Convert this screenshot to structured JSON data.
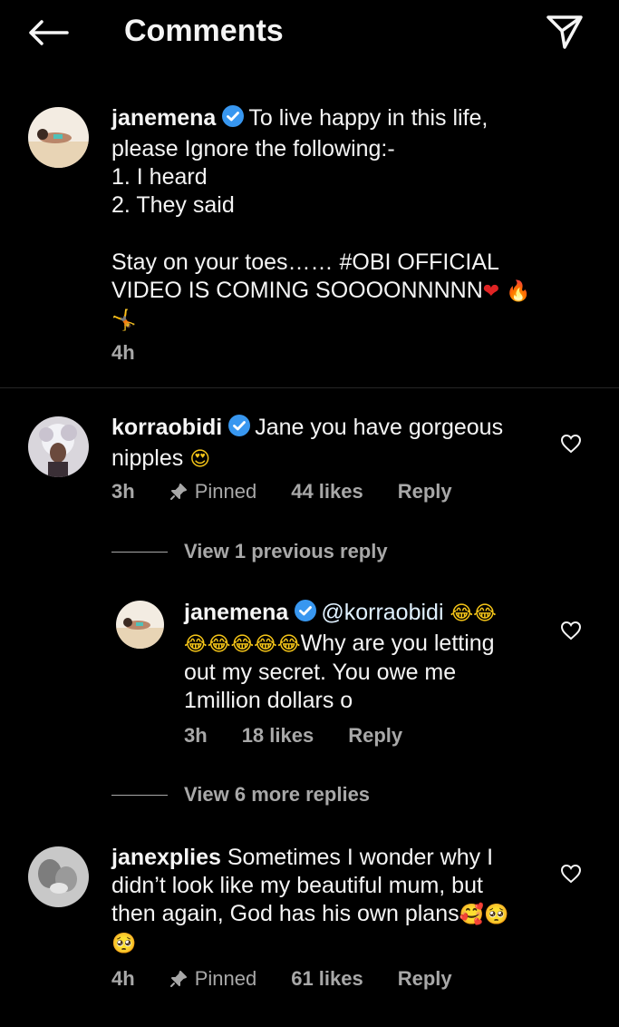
{
  "header": {
    "title": "Comments",
    "back_icon": "back-arrow-icon",
    "send_icon": "send-icon"
  },
  "colors": {
    "verified": "#3897f0",
    "muted": "#a8a8a8",
    "background": "#000000"
  },
  "caption": {
    "username": "janemena",
    "verified": true,
    "line1": "To live happy in this life,",
    "line2": "please Ignore the following:-",
    "line3": "1.  I heard",
    "line4": "2. They said",
    "line5": "Stay on your toes…… #OBI OFFICIAL",
    "line6": "VIDEO IS COMING SOOOONNNNN",
    "emoji_heart": "❤",
    "emoji_fire": "🔥",
    "emoji_person": "🤸",
    "time": "4h"
  },
  "comment1": {
    "username": "korraobidi",
    "verified": true,
    "text_a": "Jane you have gorgeous",
    "text_b": "nipples",
    "emoji": "😍",
    "time": "3h",
    "pinned": "Pinned",
    "likes": "44 likes",
    "reply": "Reply",
    "view_previous": "View 1 previous reply"
  },
  "reply1": {
    "username": "janemena",
    "verified": true,
    "mention": "@korraobidi",
    "emoji_lol": "😂",
    "text_a": "Why are you letting",
    "text_b": "out my secret. You owe me",
    "text_c": "1million dollars o",
    "time": "3h",
    "likes": "18 likes",
    "reply": "Reply",
    "view_more": "View 6 more replies"
  },
  "comment2": {
    "username": "janexplies",
    "text_a": "Sometimes I wonder why I",
    "text_b": "didn’t look like my beautiful mum, but",
    "text_c": "then again, God has his own plans",
    "emoji_love": "🥰",
    "emoji_plead": "🥺",
    "time": "4h",
    "pinned": "Pinned",
    "likes": "61 likes",
    "reply": "Reply"
  }
}
